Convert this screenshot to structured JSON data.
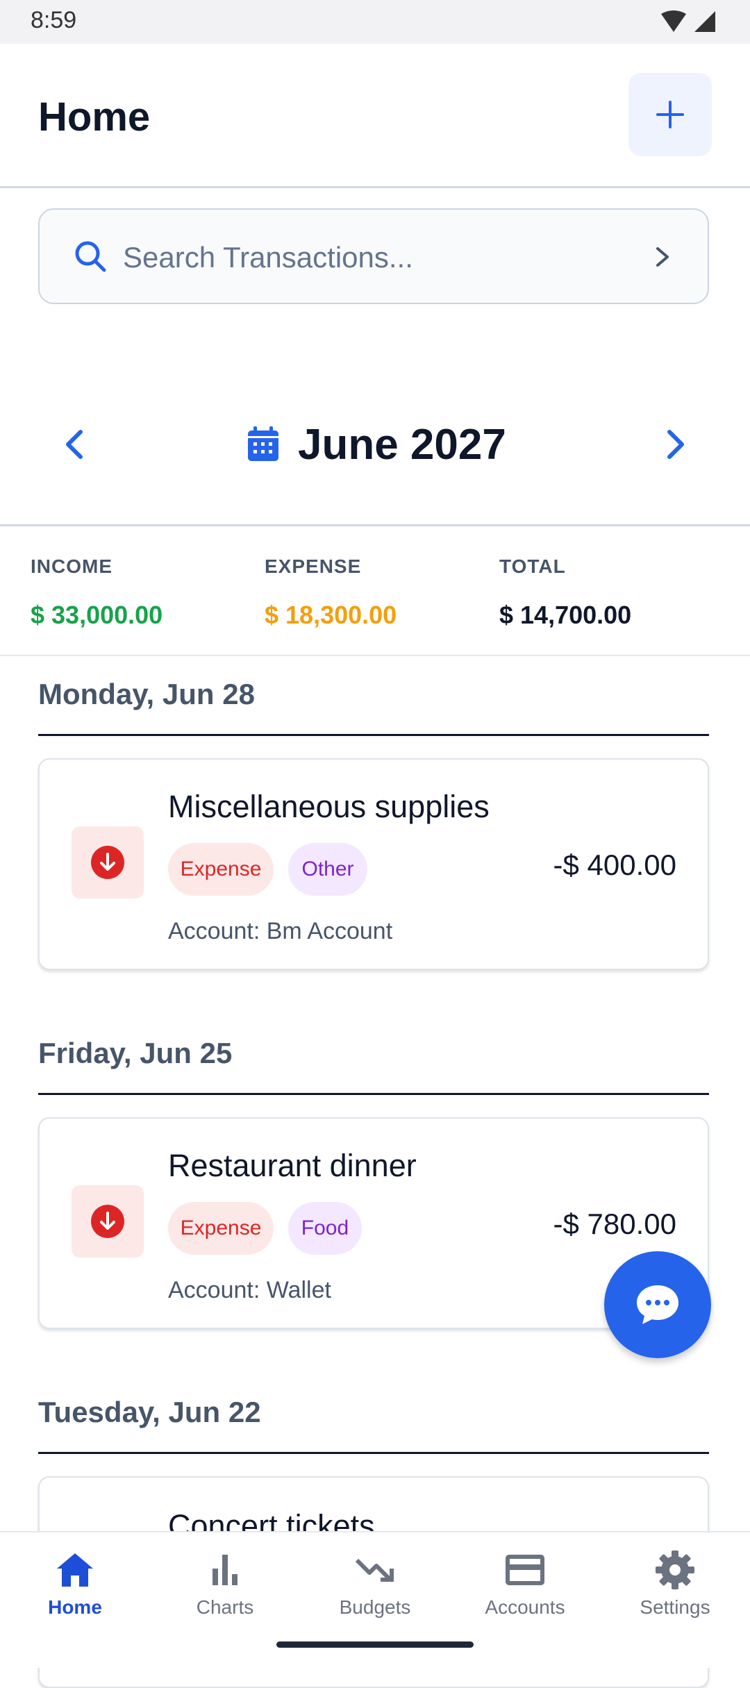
{
  "status": {
    "time": "8:59"
  },
  "header": {
    "title": "Home"
  },
  "search": {
    "placeholder": "Search Transactions..."
  },
  "month_nav": {
    "label": "June 2027"
  },
  "summary": {
    "income_label": "INCOME",
    "income_value": "$ 33,000.00",
    "expense_label": "EXPENSE",
    "expense_value": "$ 18,300.00",
    "total_label": "TOTAL",
    "total_value": "$ 14,700.00",
    "colors": {
      "income": "#16a34a",
      "expense": "#f59e0b",
      "total": "#0f172a"
    }
  },
  "days": [
    {
      "date": "Monday, Jun 28",
      "transaction": {
        "title": "Miscellaneous supplies",
        "type_tag": "Expense",
        "category_tag": "Other",
        "account": "Account: Bm Account",
        "amount": "-$ 400.00"
      }
    },
    {
      "date": "Friday, Jun 25",
      "transaction": {
        "title": "Restaurant dinner",
        "type_tag": "Expense",
        "category_tag": "Food",
        "account": "Account: Wallet",
        "amount": "-$ 780.00"
      }
    },
    {
      "date": "Tuesday, Jun 22",
      "transaction": {
        "title": "Concert tickets"
      }
    }
  ],
  "bottom_nav": {
    "items": [
      {
        "label": "Home",
        "icon": "home-icon",
        "active": true
      },
      {
        "label": "Charts",
        "icon": "bar-chart-icon",
        "active": false
      },
      {
        "label": "Budgets",
        "icon": "trending-down-icon",
        "active": false
      },
      {
        "label": "Accounts",
        "icon": "credit-card-icon",
        "active": false
      },
      {
        "label": "Settings",
        "icon": "gear-icon",
        "active": false
      }
    ]
  },
  "accent_color": "#2563eb"
}
